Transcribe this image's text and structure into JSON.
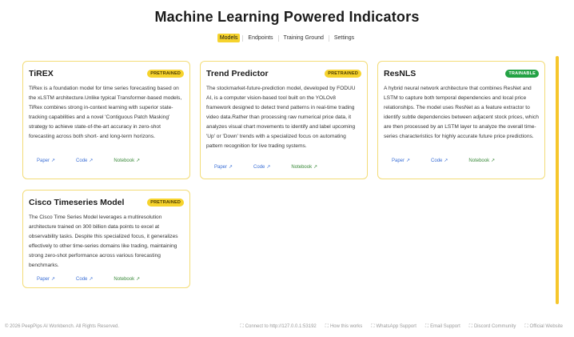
{
  "header": {
    "title": "Machine Learning Powered Indicators"
  },
  "tabs": [
    {
      "label": "Models",
      "active": true
    },
    {
      "label": "Endpoints",
      "active": false
    },
    {
      "label": "Training Ground",
      "active": false
    },
    {
      "label": "Settings",
      "active": false
    }
  ],
  "cards": [
    {
      "title": "TiREX",
      "badge": "PRETRAINED",
      "description": "TiRex is a foundation model for time series forecasting based on the xLSTM architecture.Unlike typical Transformer-based models, TiRex combines strong in-context learning with superior state-tracking capabilities and a novel 'Contiguous Patch Masking' strategy to achieve state-of-the-art accuracy in zero-shot forecasting across both short- and long-term horizons.",
      "links": {
        "paper": "Paper",
        "code": "Code",
        "notebook": "Notebook"
      }
    },
    {
      "title": "Trend Predictor",
      "badge": "PRETRAINED",
      "description": "The stockmarket-future-prediction model, developed by FODUU AI, is a computer vision-based tool built on the YOLOv8 framework designed to detect trend patterns in real-time trading video data.Rather than processing raw numerical price data, it analyzes visual chart movements to identify and label upcoming 'Up' or 'Down' trends with a specialized focus on automating pattern recognition for live trading systems.",
      "links": {
        "paper": "Paper",
        "code": "Code",
        "notebook": "Notebook"
      }
    },
    {
      "title": "ResNLS",
      "badge": "TRAINABLE",
      "description": "A hybrid neural network architecture that combines ResNet and LSTM to capture both temporal dependencies and local price relationships. The model uses ResNet as a feature extractor to identify subtle dependencies between adjacent stock prices, which are then processed by an LSTM layer to analyze the overall time-series characteristics for highly accurate future price predictions.",
      "links": {
        "paper": "Paper",
        "code": "Code",
        "notebook": "Notebook"
      }
    },
    {
      "title": "Cisco Timeseries Model",
      "badge": "PRETRAINED",
      "description": "The Cisco Time Series Model leverages a multiresolution architecture trained on 300 billion data points to excel at observability tasks. Despite this specialized focus, it generalizes effectively to other time-series domains like trading, maintaining strong zero-shot performance across various forecasting benchmarks.",
      "links": {
        "paper": "Paper",
        "code": "Code",
        "notebook": "Notebook"
      }
    }
  ],
  "footer": {
    "copyright": "© 2026 PeepPips AI Workbench. All Rights Reserved.",
    "links": [
      "Connect to http://127.0.0.1:53192",
      "How this works",
      "WhatsApp Support",
      "Email Support",
      "Discord Community",
      "Official Website"
    ]
  },
  "colors": {
    "accent": "#f6d32d",
    "card_border": "#f3dc77",
    "trainable": "#23a244",
    "link_blue": "#3b6fd6",
    "link_green": "#3a8a3a",
    "scrollbar": "#f6c62c"
  },
  "icons": {
    "external_link": "external-link-icon",
    "footer_link": "footer-link-icon"
  }
}
